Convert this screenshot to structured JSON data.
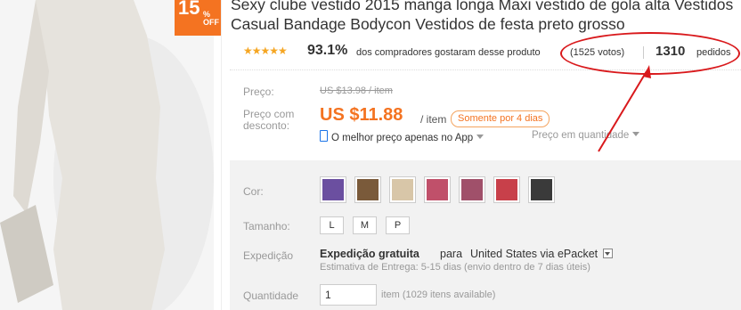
{
  "badge": {
    "percent": "15",
    "percent_sign": "%",
    "off": "OFF"
  },
  "title": "Sexy clube vestido 2015 manga longa Maxi vestido de gola alta Vestidos Casual Bandage Bodycon Vestidos de festa preto grosso",
  "rating": {
    "stars": "★★★★★",
    "percent": "93.1%",
    "liked_text": "dos compradores gostaram desse produto",
    "votes": "(1525 votos)",
    "orders_count": "1310",
    "orders_label": "pedidos"
  },
  "price": {
    "label": "Preço:",
    "old": "US $13.98 / item",
    "discount_label": "Preço com desconto:",
    "new": "US $11.88",
    "per_item": "/ item",
    "only_days": "Somente por 4 dias",
    "app_text": "O melhor preço apenas no App",
    "qty_price": "Preço em quantidade"
  },
  "options": {
    "color_label": "Cor:",
    "swatches": [
      {
        "name": "blue-purple",
        "color": "#6b4fa0"
      },
      {
        "name": "leopard",
        "color": "#7a5a3a"
      },
      {
        "name": "beige",
        "color": "#d8c6a8"
      },
      {
        "name": "pink-black",
        "color": "#c0506a"
      },
      {
        "name": "purple-pink",
        "color": "#a0506a"
      },
      {
        "name": "red-pink",
        "color": "#c8404a"
      },
      {
        "name": "black-white",
        "color": "#3a3a3a"
      }
    ],
    "size_label": "Tamanho:",
    "sizes": [
      "L",
      "M",
      "P"
    ],
    "shipping_label": "Expedição",
    "shipping_free": "Expedição gratuita",
    "shipping_for": "para",
    "shipping_dest": "United States via ePacket",
    "estimate": "Estimativa de Entrega: 5-15 dias (envio dentro de 7 dias úteis)",
    "qty_label": "Quantidade",
    "qty_value": "1",
    "available": "item (1029 itens available)"
  },
  "colors": {
    "accent": "#f47321",
    "annotation": "#d9191c",
    "panel": "#f2f2f2"
  }
}
